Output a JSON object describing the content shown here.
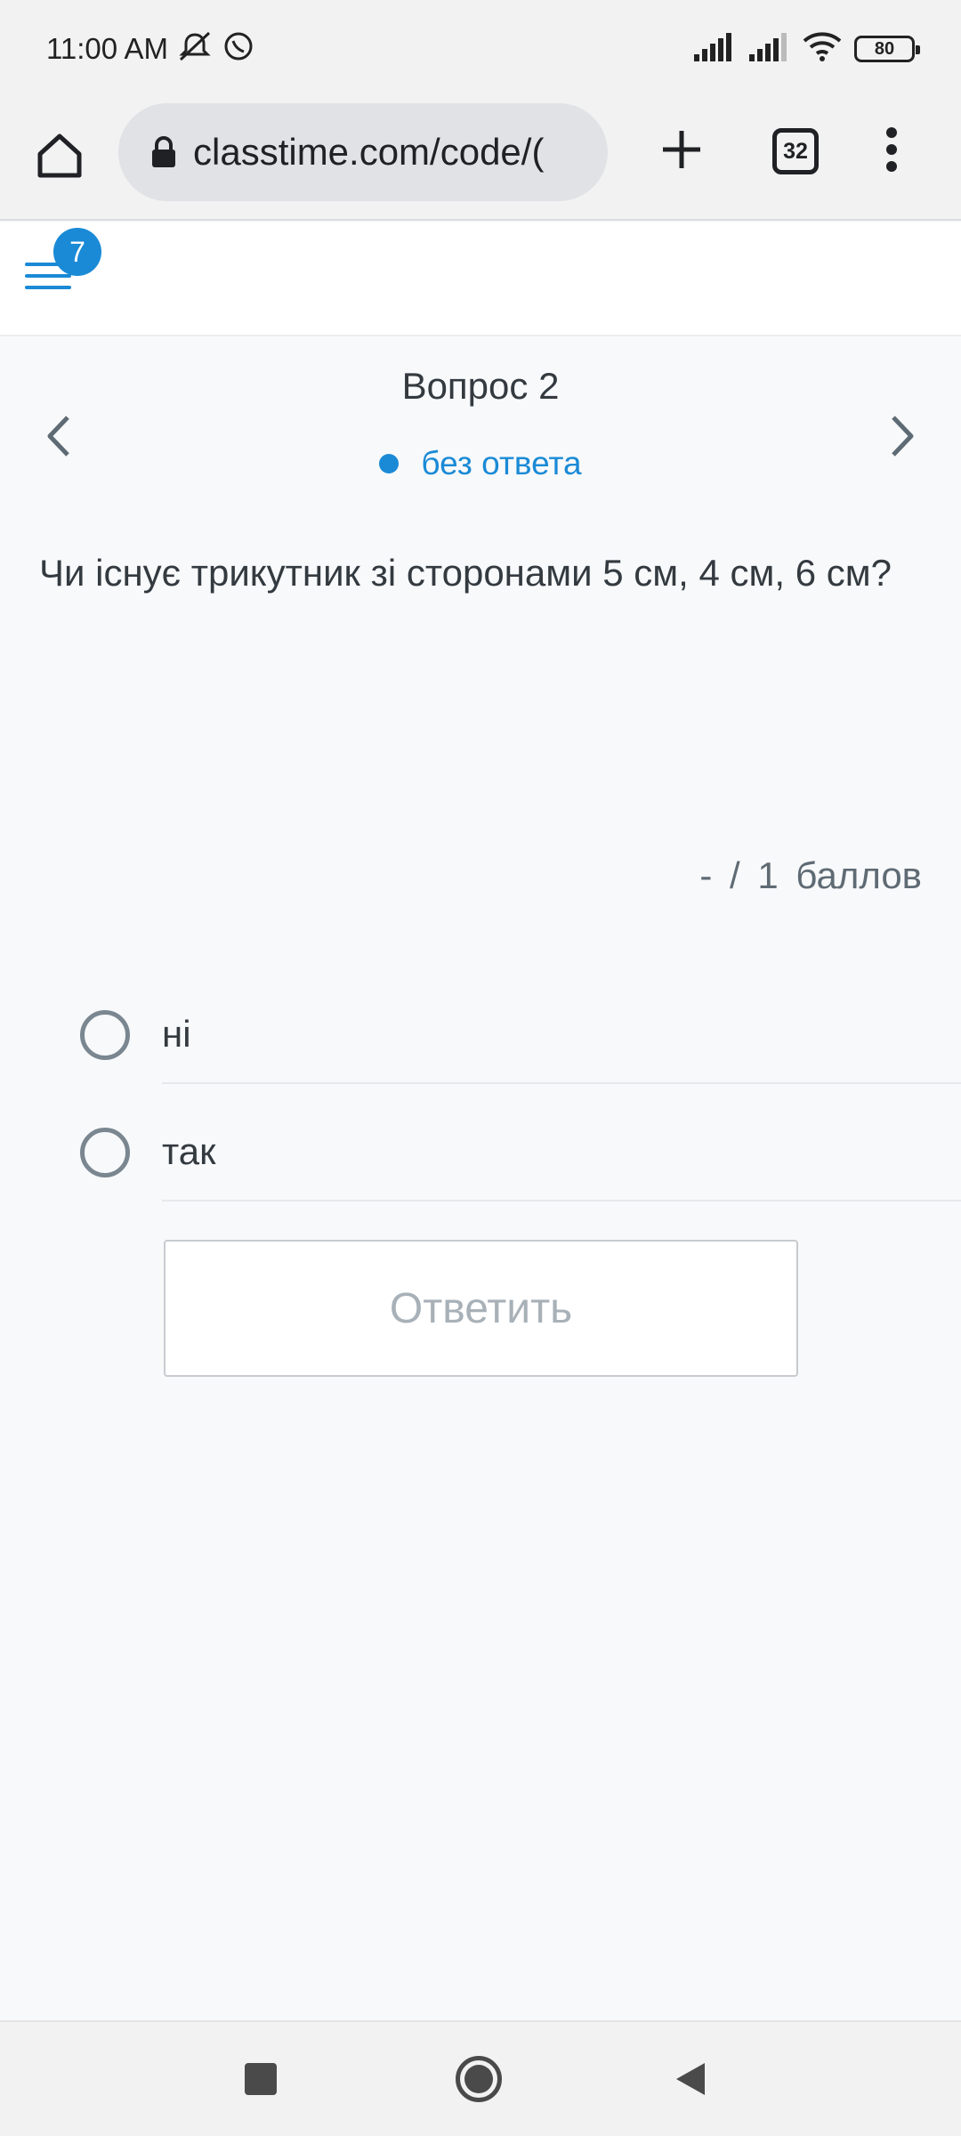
{
  "status_bar": {
    "time": "11:00 AM",
    "battery": "80",
    "icons": [
      "mute-icon",
      "viber-icon",
      "signal-icon",
      "signal-icon",
      "wifi-icon",
      "battery-icon"
    ]
  },
  "browser": {
    "url": "classtime.com/code/(",
    "tab_count": "32"
  },
  "app": {
    "notification_count": "7"
  },
  "question": {
    "title": "Вопрос 2",
    "status": "без ответа",
    "text": "Чи існує трикутник зі сторонами 5 см, 4 см, 6 см?",
    "score": "- / 1 баллов",
    "options": [
      {
        "label": "ні",
        "selected": false
      },
      {
        "label": "так",
        "selected": false
      }
    ],
    "submit_label": "Ответить"
  },
  "colors": {
    "accent": "#1a8ad6",
    "text": "#333a40",
    "disabled_text": "#a8b1b8",
    "background": "#f8f9fb"
  }
}
